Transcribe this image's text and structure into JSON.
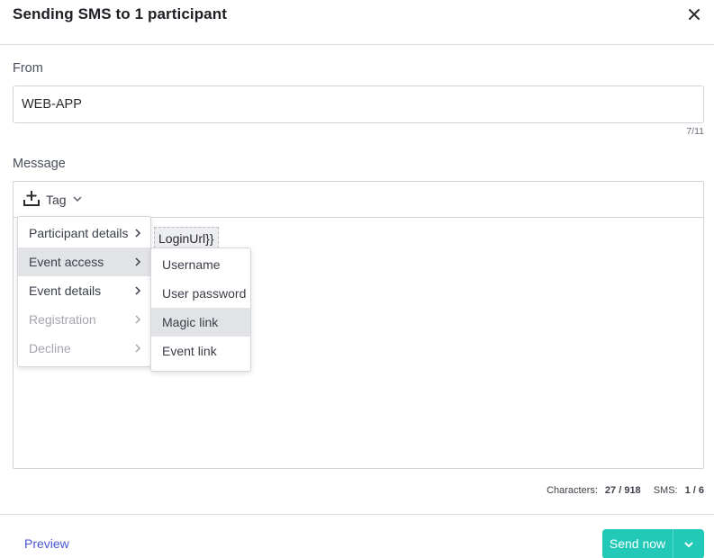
{
  "header": {
    "title": "Sending SMS to 1 participant",
    "close_icon": "close-icon"
  },
  "from": {
    "label": "From",
    "value": "WEB-APP",
    "placeholder": "",
    "counter": "7/11"
  },
  "message": {
    "label": "Message",
    "tag_button_label": "Tag",
    "tag_icon": "insert-icon",
    "token_text": "LoginUrl}}"
  },
  "tag_menu": {
    "items": [
      {
        "label": "Participant details",
        "active": false,
        "disabled": false
      },
      {
        "label": "Event access",
        "active": true,
        "disabled": false
      },
      {
        "label": "Event details",
        "active": false,
        "disabled": false
      },
      {
        "label": "Registration",
        "active": false,
        "disabled": true
      },
      {
        "label": "Decline",
        "active": false,
        "disabled": true
      }
    ],
    "submenu": {
      "items": [
        {
          "label": "Username",
          "active": false
        },
        {
          "label": "User password",
          "active": false
        },
        {
          "label": "Magic link",
          "active": true
        },
        {
          "label": "Event link",
          "active": false
        }
      ]
    }
  },
  "counts": {
    "characters_label": "Characters:",
    "characters_value": "27 / 918",
    "sms_label": "SMS:",
    "sms_value": "1 / 6"
  },
  "footer": {
    "preview_label": "Preview",
    "send_label": "Send now"
  },
  "colors": {
    "accent": "#21c9b6",
    "link": "#4b55d6",
    "menu_active": "#e2e3e6"
  }
}
